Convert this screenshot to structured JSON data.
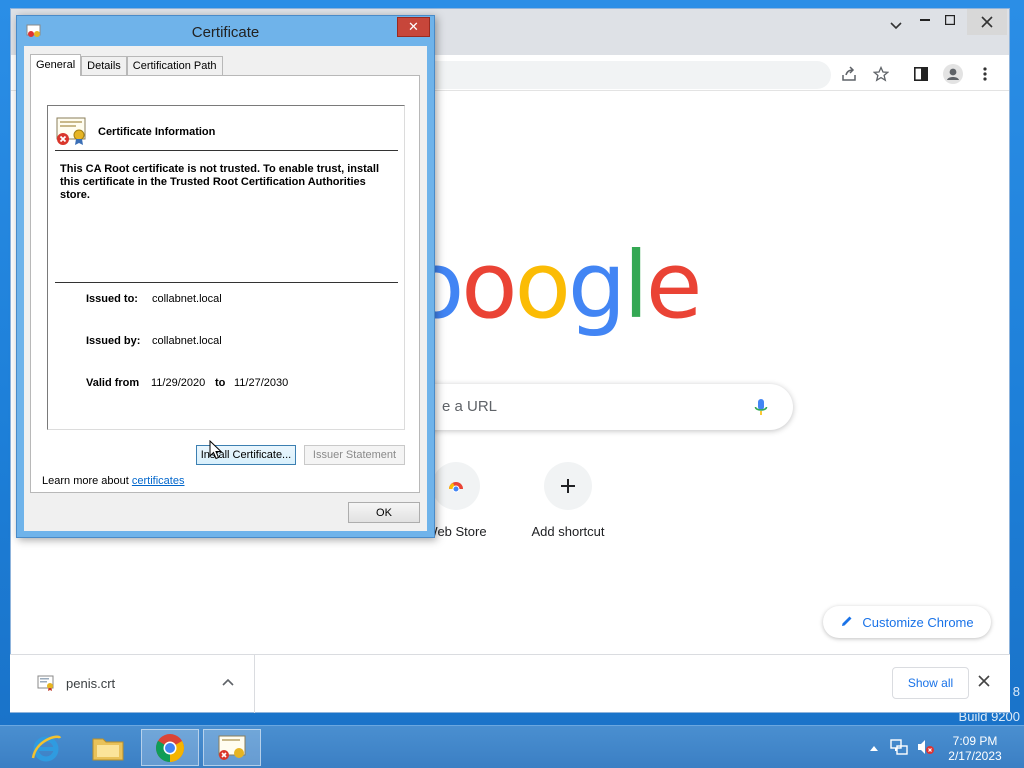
{
  "desktop": {
    "watermark_line1": "8",
    "watermark_line2": "Build 9200"
  },
  "browser": {
    "new_tab": {
      "search_placeholder": "e a URL",
      "shortcuts": [
        {
          "label": "Web Store",
          "icon": "chrome-web-store-icon"
        },
        {
          "label": "Add shortcut",
          "icon": "plus-icon"
        }
      ],
      "customize_label": "Customize Chrome"
    },
    "download_bar": {
      "file_name": "penis.crt",
      "show_all_label": "Show all"
    }
  },
  "dialog": {
    "title": "Certificate",
    "close_glyph": "✕",
    "tabs": [
      {
        "label": "General",
        "active": true
      },
      {
        "label": "Details",
        "active": false
      },
      {
        "label": "Certification Path",
        "active": false
      }
    ],
    "info_heading": "Certificate Information",
    "info_message": "This CA Root certificate is not trusted. To enable trust, install this certificate in the Trusted Root Certification Authorities store.",
    "issued_to_label": "Issued to:",
    "issued_to_value": "collabnet.local",
    "issued_by_label": "Issued by:",
    "issued_by_value": "collabnet.local",
    "valid_from_label": "Valid from",
    "valid_from_value": "11/29/2020",
    "valid_to_label": "to",
    "valid_to_value": "11/27/2030",
    "install_button": "Install Certificate...",
    "issuer_statement_button": "Issuer Statement",
    "learn_more_prefix": "Learn more about",
    "learn_more_link": "certificates",
    "ok_button": "OK"
  },
  "taskbar": {
    "time": "7:09 PM",
    "date": "2/17/2023",
    "apps": [
      "internet-explorer-icon",
      "file-explorer-icon",
      "chrome-icon",
      "certificate-icon"
    ]
  },
  "colors": {
    "google_blue": "#4285f4",
    "google_red": "#ea4335",
    "google_yellow": "#fbbc05",
    "google_green": "#34a853",
    "link_blue": "#1a73e8",
    "taskbar_blue": "#3b7fc4"
  }
}
